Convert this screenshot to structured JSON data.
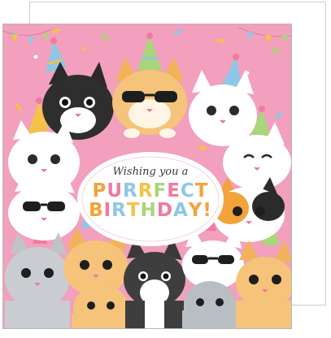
{
  "card": {
    "greeting_line1": "Wishing you a",
    "greeting_line2": "PURRFECT",
    "greeting_line3": "BIRTHDAY!"
  },
  "colors": {
    "background": "#f2a0bd",
    "letters": [
      "#f2a33a",
      "#f07aa0",
      "#8ec7e6",
      "#f2c24a",
      "#a9d67a",
      "#f07aa0",
      "#8ec7e6",
      "#f2a33a"
    ]
  }
}
